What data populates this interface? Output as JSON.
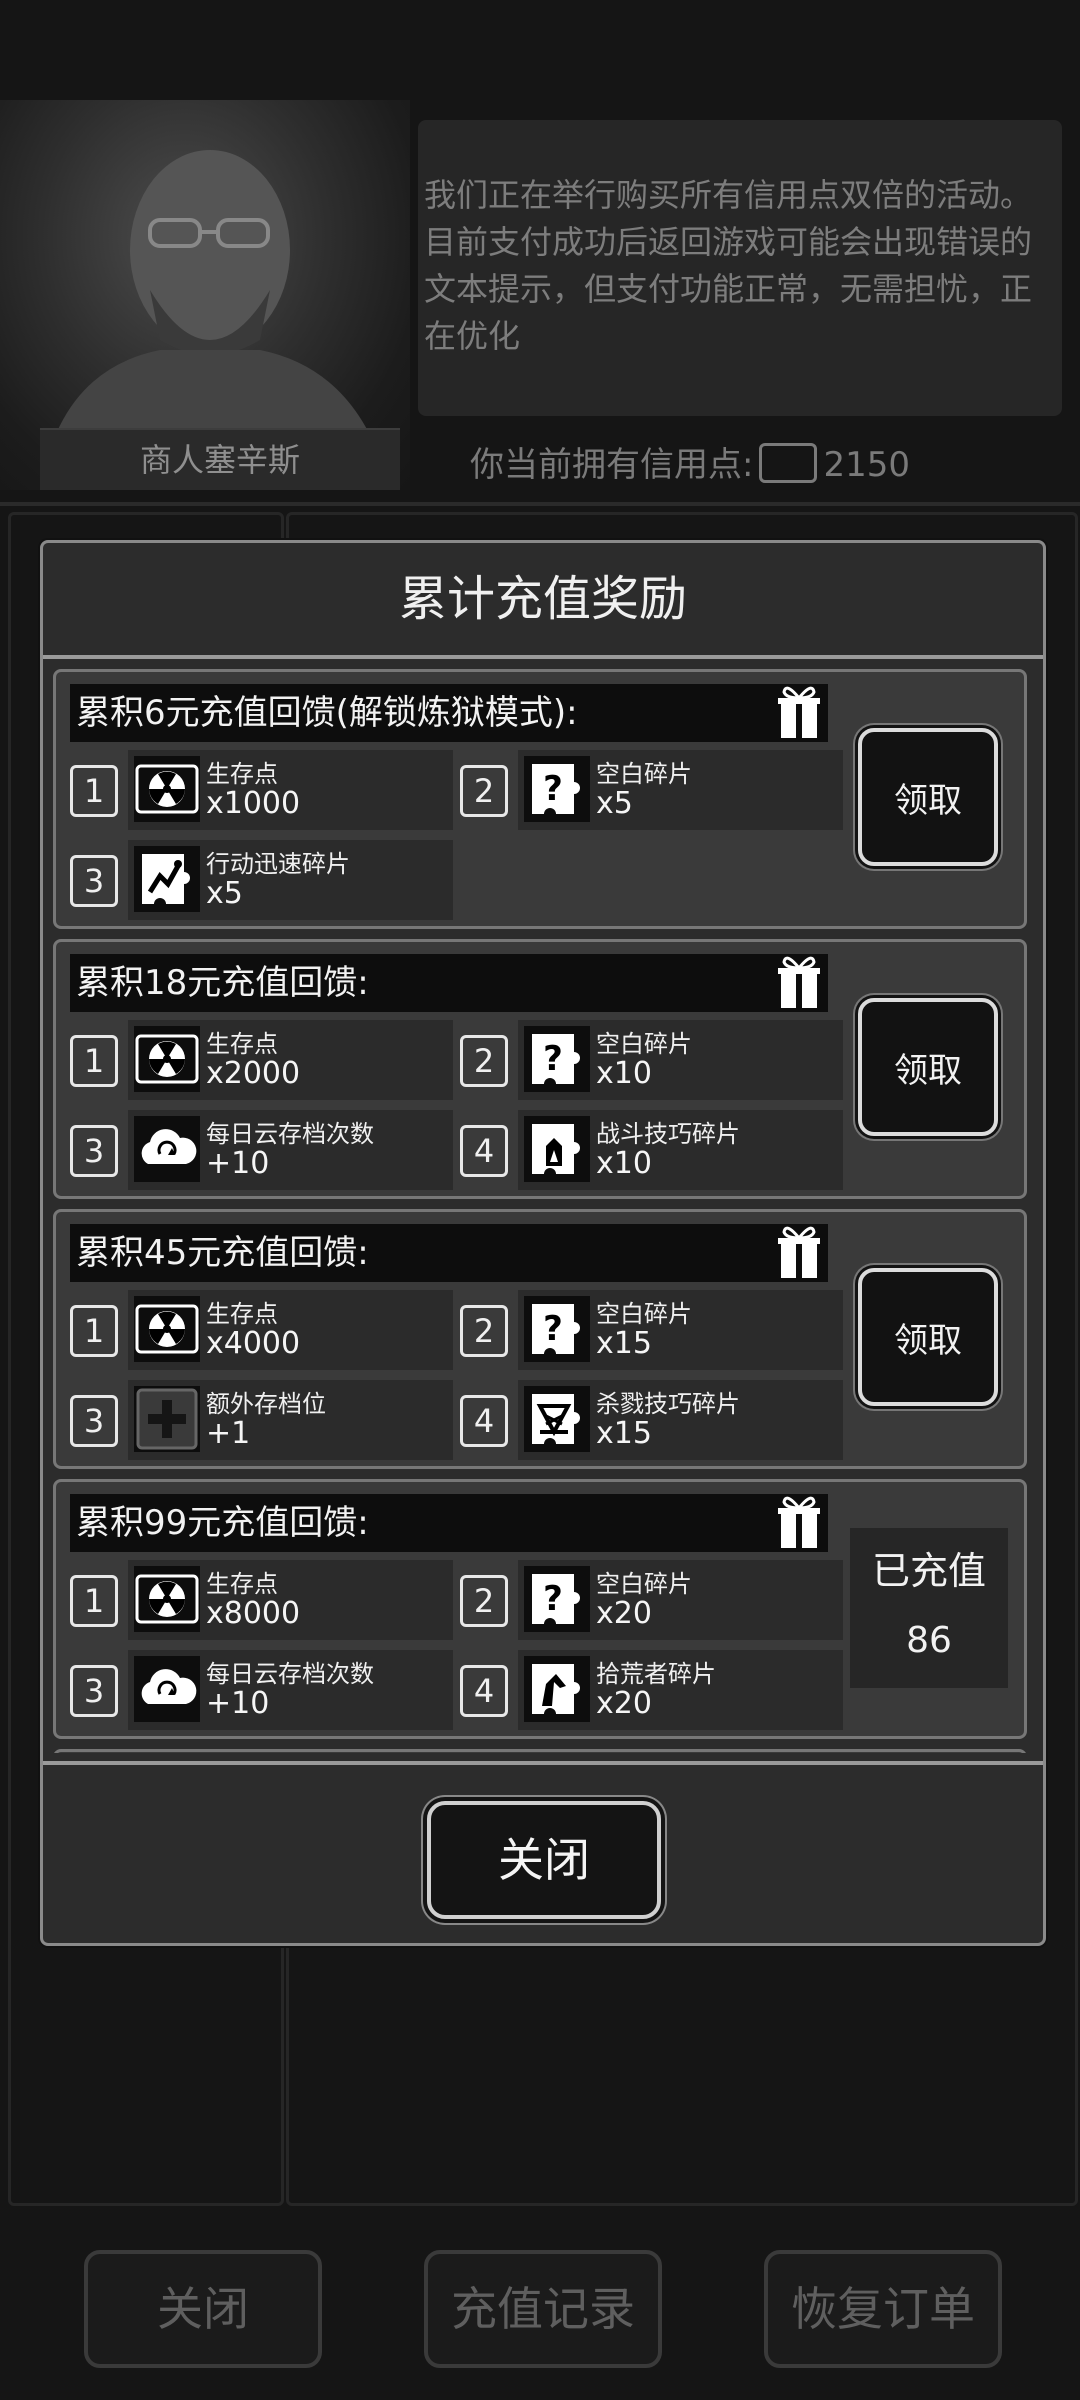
{
  "shop": {
    "merchant_name": "商人塞辛斯",
    "message": "我们正在举行购买所有信用点双倍的活动。目前支付成功后返回游戏可能会出现错误的文本提示，但支付功能正常，无需担忧，正在优化",
    "credits_label": "你当前拥有信用点:",
    "credits_value": "2150",
    "buttons": {
      "close": "关闭",
      "history": "充值记录",
      "restore": "恢复订单"
    }
  },
  "dialog": {
    "title": "累计充值奖励",
    "close_label": "关闭",
    "tiers": [
      {
        "title": "累积6元充值回馈(解锁炼狱模式):",
        "action": "领取",
        "rewards": [
          {
            "num": "1",
            "name": "生存点",
            "qty": "x1000",
            "icon": "radiation-icon"
          },
          {
            "num": "2",
            "name": "空白碎片",
            "qty": "x5",
            "icon": "puzzle-question-icon"
          },
          {
            "num": "3",
            "name": "行动迅速碎片",
            "qty": "x5",
            "icon": "puzzle-speed-icon"
          }
        ]
      },
      {
        "title": "累积18元充值回馈:",
        "action": "领取",
        "rewards": [
          {
            "num": "1",
            "name": "生存点",
            "qty": "x2000",
            "icon": "radiation-icon"
          },
          {
            "num": "2",
            "name": "空白碎片",
            "qty": "x10",
            "icon": "puzzle-question-icon"
          },
          {
            "num": "3",
            "name": "每日云存档次数",
            "qty": "+10",
            "icon": "cloud-sync-icon"
          },
          {
            "num": "4",
            "name": "战斗技巧碎片",
            "qty": "x10",
            "icon": "puzzle-fight-icon"
          }
        ]
      },
      {
        "title": "累积45元充值回馈:",
        "action": "领取",
        "rewards": [
          {
            "num": "1",
            "name": "生存点",
            "qty": "x4000",
            "icon": "radiation-icon"
          },
          {
            "num": "2",
            "name": "空白碎片",
            "qty": "x15",
            "icon": "puzzle-question-icon"
          },
          {
            "num": "3",
            "name": "额外存档位",
            "qty": "+1",
            "icon": "plus-slot-icon"
          },
          {
            "num": "4",
            "name": "杀戮技巧碎片",
            "qty": "x15",
            "icon": "puzzle-kill-icon"
          }
        ]
      },
      {
        "title": "累积99元充值回馈:",
        "status_label": "已充值",
        "status_value": "86",
        "rewards": [
          {
            "num": "1",
            "name": "生存点",
            "qty": "x8000",
            "icon": "radiation-icon"
          },
          {
            "num": "2",
            "name": "空白碎片",
            "qty": "x20",
            "icon": "puzzle-question-icon"
          },
          {
            "num": "3",
            "name": "每日云存档次数",
            "qty": "+10",
            "icon": "cloud-sync-icon"
          },
          {
            "num": "4",
            "name": "拾荒者碎片",
            "qty": "x20",
            "icon": "puzzle-scavenger-icon"
          }
        ]
      }
    ]
  }
}
